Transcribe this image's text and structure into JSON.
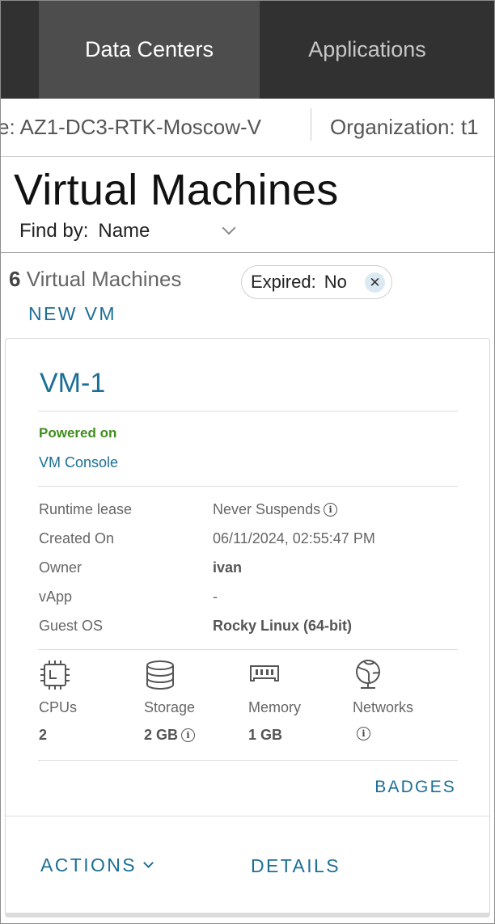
{
  "nav": {
    "tabs": [
      {
        "label": "Data Centers",
        "active": true
      },
      {
        "label": "Applications",
        "active": false
      }
    ]
  },
  "context": {
    "site": "e:  AZ1-DC3-RTK-Moscow-V",
    "organization": "Organization:  t1"
  },
  "page": {
    "title": "Virtual Machines",
    "find_by_label": "Find by:",
    "find_by_value": "Name",
    "count_number": "6",
    "count_text": "Virtual Machines",
    "filter_label": "Expired:",
    "filter_value": "No",
    "new_vm_label": "NEW VM"
  },
  "card": {
    "name": "VM-1",
    "status": "Powered on",
    "console_link": "VM Console",
    "properties": [
      {
        "label": "Runtime lease",
        "value": "Never Suspends"
      },
      {
        "label": "Created On",
        "value": "06/11/2024, 02:55:47 PM"
      },
      {
        "label": "Owner",
        "value": "ivan"
      },
      {
        "label": "vApp",
        "value": "-"
      },
      {
        "label": "Guest OS",
        "value": "Rocky Linux (64-bit)"
      }
    ],
    "resources": [
      {
        "label": "CPUs",
        "value": "2",
        "icon": "cpu-icon"
      },
      {
        "label": "Storage",
        "value": "2 GB",
        "icon": "storage-icon"
      },
      {
        "label": "Memory",
        "value": "1 GB",
        "icon": "memory-icon"
      },
      {
        "label": "Networks",
        "value": "",
        "icon": "network-icon"
      }
    ],
    "badges_label": "BADGES",
    "actions_label": "ACTIONS",
    "details_label": "DETAILS"
  },
  "colors": {
    "nav_bg": "#313131",
    "nav_active": "#4d4d4d",
    "link": "#1b6f96",
    "status_on": "#3e8e1c"
  }
}
